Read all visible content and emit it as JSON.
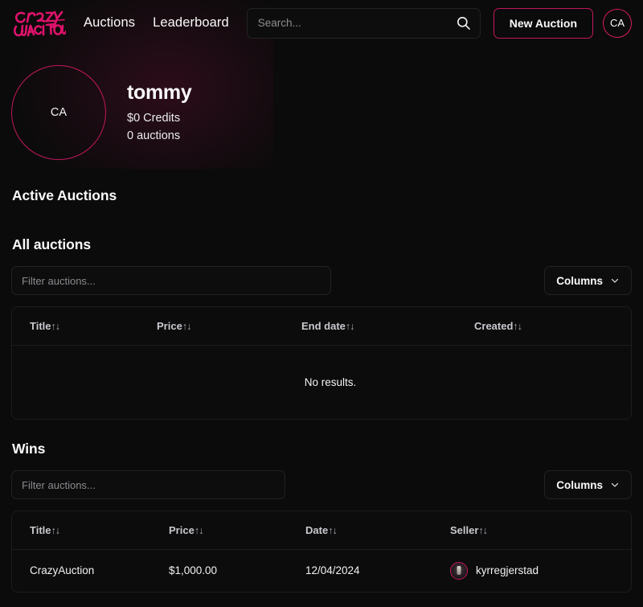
{
  "brand": {
    "logo_text": "CrazyAuction",
    "accent": "#d81b60",
    "accent_border": "#c2185b"
  },
  "header": {
    "nav": [
      {
        "label": "Auctions",
        "name": "nav-auctions"
      },
      {
        "label": "Leaderboard",
        "name": "nav-leaderboard"
      }
    ],
    "search": {
      "placeholder": "Search...",
      "value": "",
      "icon": "search-icon"
    },
    "new_auction_label": "New Auction",
    "avatar_initials": "CA"
  },
  "profile": {
    "avatar_initials": "CA",
    "name": "tommy",
    "credits": "$0 Credits",
    "auctions": "0 auctions"
  },
  "sections": {
    "active_auctions_title": "Active Auctions",
    "all_auctions_title": "All auctions",
    "wins_title": "Wins"
  },
  "all_auctions": {
    "filter_placeholder": "Filter auctions...",
    "filter_value": "",
    "columns_label": "Columns",
    "headers": [
      {
        "label": "Title",
        "sort": "↑↓"
      },
      {
        "label": "Price",
        "sort": "↑↓"
      },
      {
        "label": "End date",
        "sort": "↑↓"
      },
      {
        "label": "Created",
        "sort": "↑↓"
      }
    ],
    "rows": [],
    "empty_text": "No results."
  },
  "wins": {
    "filter_placeholder": "Filter auctions...",
    "filter_value": "",
    "columns_label": "Columns",
    "headers": [
      {
        "label": "Title",
        "sort": "↑↓"
      },
      {
        "label": "Price",
        "sort": "↑↓"
      },
      {
        "label": "Date",
        "sort": "↑↓"
      },
      {
        "label": "Seller",
        "sort": "↑↓"
      }
    ],
    "rows": [
      {
        "title": "CrazyAuction",
        "price": "$1,000.00",
        "date": "12/04/2024",
        "seller": "kyrregjerstad"
      }
    ]
  }
}
